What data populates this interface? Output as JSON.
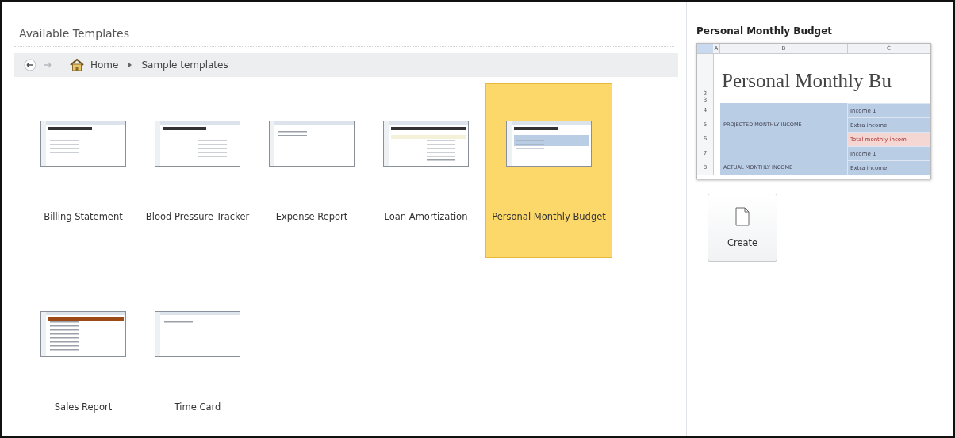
{
  "header": {
    "title": "Available Templates"
  },
  "breadcrumb": {
    "items": [
      {
        "label": "Home",
        "kind": "home"
      },
      {
        "label": "Sample templates",
        "kind": "plain"
      }
    ]
  },
  "templates": [
    {
      "label": "Billing Statement",
      "kind": "billing",
      "selected": false
    },
    {
      "label": "Blood Pressure Tracker",
      "kind": "tracker",
      "selected": false
    },
    {
      "label": "Expense Report",
      "kind": "expense",
      "selected": false
    },
    {
      "label": "Loan Amortization",
      "kind": "loan",
      "selected": false
    },
    {
      "label": "Personal Monthly Budget",
      "kind": "budget",
      "selected": true
    },
    {
      "label": "Sales Report",
      "kind": "sales",
      "selected": false
    },
    {
      "label": "Time Card",
      "kind": "timecard",
      "selected": false
    }
  ],
  "preview": {
    "title": "Personal Monthly Budget",
    "columns": [
      "A",
      "B",
      "C"
    ],
    "sheet_title": "Personal Monthly Bu",
    "title_rows": [
      "2",
      "3"
    ],
    "rows": [
      {
        "number": "4",
        "item": "Income 1",
        "highlight": false
      },
      {
        "number": "5",
        "label": "PROJECTED MONTHLY INCOME",
        "item": "Extra income",
        "highlight": false
      },
      {
        "number": "6",
        "item": "Total monthly incom",
        "highlight": true
      },
      {
        "number": "7",
        "item": "Income 1",
        "highlight": false
      },
      {
        "number": "8",
        "label": "ACTUAL MONTHLY INCOME",
        "item": "Extra income",
        "highlight": false
      }
    ]
  },
  "create_button": {
    "label": "Create"
  }
}
